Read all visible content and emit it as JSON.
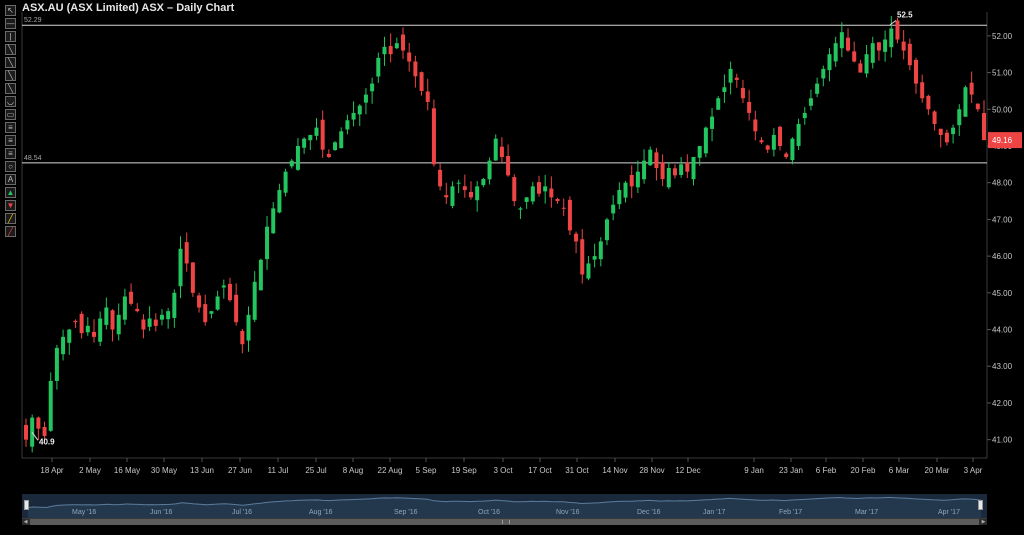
{
  "title": "ASX.AU (ASX Limited) ASX – Daily Chart",
  "toolbar": {
    "icons": [
      "pointer-icon",
      "horizontal-line-icon",
      "vertical-line-icon",
      "trend-line-icon",
      "ray-icon",
      "parallel-channel-icon",
      "extended-line-icon",
      "arc-icon",
      "rectangle-icon",
      "fibonacci-icon",
      "gann-fan-icon",
      "andrews-pitchfork-icon",
      "circle-icon",
      "text-icon",
      "up-arrow-icon",
      "down-arrow-icon",
      "highlighter-icon",
      "eraser-icon"
    ]
  },
  "colors": {
    "up": "#22c55e",
    "down": "#ef4444",
    "line": "#d8d8d8",
    "price_box": "#ef4444"
  },
  "chart_data": {
    "type": "candlestick",
    "y_ticks": [
      41.0,
      42.0,
      43.0,
      44.0,
      45.0,
      46.0,
      47.0,
      48.0,
      49.0,
      50.0,
      51.0,
      52.0
    ],
    "x_ticks": [
      "18 Apr",
      "2 May",
      "16 May",
      "30 May",
      "13 Jun",
      "27 Jun",
      "11 Jul",
      "25 Jul",
      "8 Aug",
      "22 Aug",
      "5 Sep",
      "19 Sep",
      "3 Oct",
      "17 Oct",
      "31 Oct",
      "14 Nov",
      "28 Nov",
      "12 Dec",
      "9 Jan",
      "23 Jan",
      "6 Feb",
      "20 Feb",
      "6 Mar",
      "20 Mar",
      "3 Apr"
    ],
    "horizontal_lines": [
      {
        "value": 52.29,
        "label": "52.29"
      },
      {
        "value": 48.54,
        "label": "48.54"
      }
    ],
    "annotations": [
      {
        "label": "52.5",
        "value": 52.5
      },
      {
        "label": "40.9",
        "value": 40.9
      }
    ],
    "last_price": "49.16",
    "closes": [
      41.0,
      41.6,
      41.3,
      41.1,
      42.6,
      43.5,
      43.8,
      44.0,
      44.2,
      43.9,
      44.1,
      43.8,
      44.3,
      44.6,
      44.0,
      44.4,
      44.9,
      44.7,
      44.5,
      44.0,
      44.3,
      44.1,
      44.4,
      44.5,
      45.0,
      46.2,
      45.8,
      45.0,
      44.6,
      44.2,
      44.5,
      44.9,
      45.2,
      44.8,
      44.2,
      43.6,
      44.4,
      45.3,
      45.9,
      46.8,
      47.3,
      47.8,
      48.3,
      48.6,
      49.0,
      49.2,
      49.3,
      49.5,
      48.9,
      48.7,
      49.1,
      49.4,
      49.7,
      49.9,
      50.1,
      50.4,
      50.7,
      51.4,
      51.7,
      51.5,
      51.8,
      51.6,
      51.3,
      50.9,
      50.5,
      50.2,
      48.5,
      47.9,
      47.6,
      47.9,
      48.0,
      47.8,
      47.6,
      47.9,
      48.1,
      48.6,
      49.2,
      48.7,
      48.2,
      47.5,
      47.3,
      47.6,
      47.9,
      47.7,
      47.9,
      47.6,
      47.5,
      47.3,
      46.7,
      46.4,
      45.5,
      45.8,
      46.0,
      46.4,
      47.0,
      47.4,
      47.8,
      48.0,
      47.9,
      48.3,
      48.6,
      48.9,
      48.4,
      48.1,
      48.4,
      48.2,
      48.5,
      48.3,
      48.7,
      49.0,
      49.5,
      49.8,
      50.3,
      50.6,
      51.1,
      50.8,
      50.3,
      49.9,
      49.4,
      49.1,
      48.9,
      49.3,
      49.0,
      48.7,
      49.2,
      49.6,
      49.9,
      50.3,
      50.7,
      51.1,
      51.5,
      51.8,
      52.1,
      51.6,
      51.3,
      51.0,
      51.5,
      51.8,
      51.6,
      51.9,
      52.2,
      51.9,
      51.6,
      51.2,
      50.7,
      50.3,
      50.0,
      49.6,
      49.3,
      49.1,
      49.5,
      50.0,
      50.6,
      50.4,
      50.0,
      49.16
    ]
  },
  "navigator": {
    "months": [
      "May '16",
      "Jun '16",
      "Jul '16",
      "Aug '16",
      "Sep '16",
      "Oct '16",
      "Nov '16",
      "Dec '16",
      "Jan '17",
      "Feb '17",
      "Mar '17",
      "Apr '17"
    ]
  }
}
